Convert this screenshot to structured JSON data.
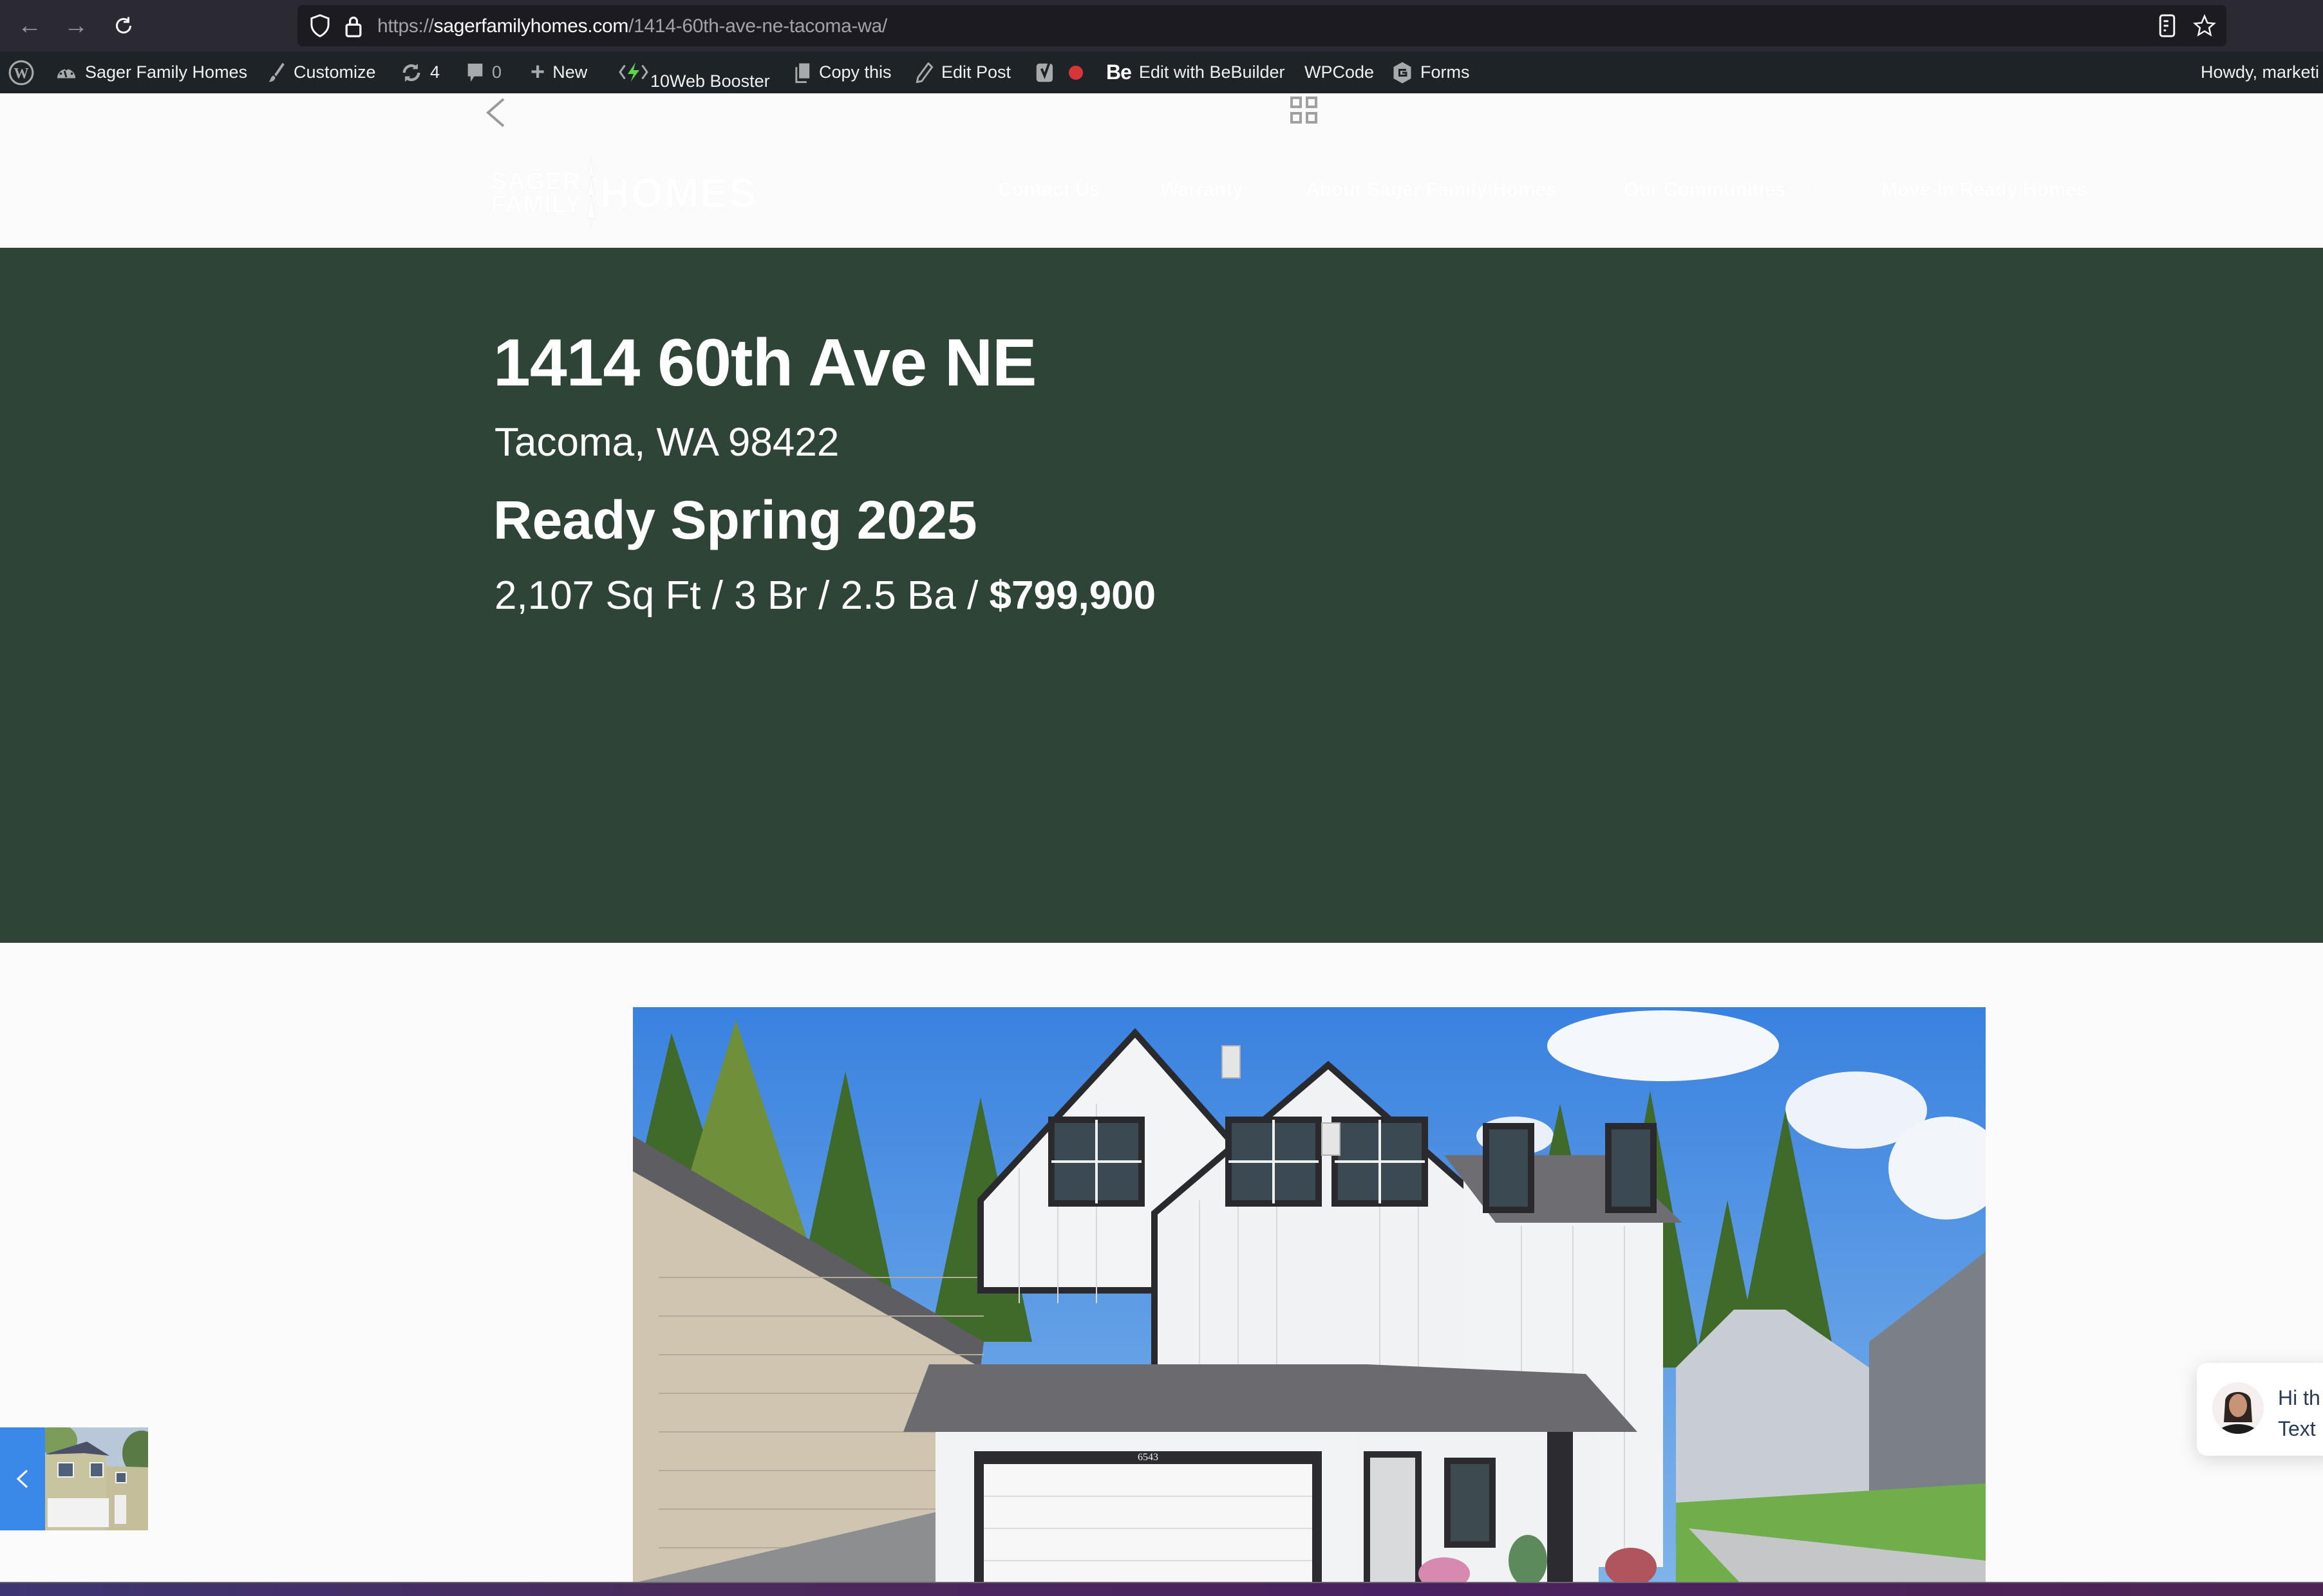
{
  "browser": {
    "url_scheme": "https://",
    "url_domain": "sagerfamilyhomes.com",
    "url_path": "/1414-60th-ave-ne-tacoma-wa/",
    "icons": [
      "back-arrow-icon",
      "forward-arrow-icon",
      "reload-icon",
      "shield-icon",
      "lock-icon",
      "reader-view-icon",
      "bookmark-star-icon"
    ]
  },
  "admin_bar": {
    "site_name": "Sager Family Homes",
    "customize": "Customize",
    "updates_count": "4",
    "comments_count": "0",
    "new": "New",
    "booster": "10Web Booster",
    "copy": "Copy this",
    "edit_post": "Edit Post",
    "bebuilder_badge": "Be",
    "bebuilder": "Edit with BeBuilder",
    "wpcode": "WPCode",
    "forms": "Forms",
    "howdy": "Howdy, marketi",
    "seo_status_color": "#d63638"
  },
  "site_header": {
    "logo": {
      "line1": "SAGER",
      "line2": "FAMILY",
      "word": "HOMES"
    },
    "nav": [
      {
        "label": "Contact Us"
      },
      {
        "label": "Warranty"
      },
      {
        "label": "About Sager Family Homes"
      },
      {
        "label": "Our Communities",
        "has_dropdown": true,
        "dropdown_icon": "↓"
      },
      {
        "label": "Move-In Ready Homes"
      }
    ]
  },
  "listing": {
    "address": "1414 60th Ave NE",
    "city_state_zip": "Tacoma, WA 98422",
    "availability": "Ready Spring 2025",
    "specs": "2,107 Sq Ft / 3 Br / 2.5 Ba / ",
    "price": "$799,900",
    "house_number_on_photo": "6543"
  },
  "chat_widget": {
    "line1": "Hi th",
    "line2": "Text"
  },
  "colors": {
    "hero_bg": "#2d4436",
    "admin_bar_bg": "#1d2327",
    "browser_bg": "#2b2a33",
    "thumb_nav_bg": "#3a88e8"
  }
}
